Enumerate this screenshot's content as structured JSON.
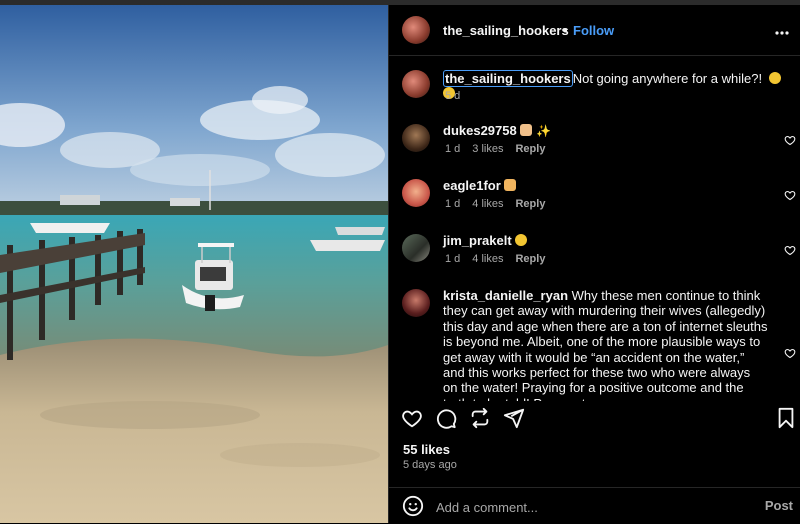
{
  "post": {
    "author": "the_sailing_hookers",
    "separator": "•",
    "follow_label": "Follow",
    "more_label": "•••",
    "caption": {
      "username": "the_sailing_hookers",
      "text": "Not going anywhere for a while?!",
      "time": "5 d"
    }
  },
  "comments": [
    {
      "username": "dukes29758",
      "text": "",
      "time": "1 d",
      "likes": "3 likes",
      "reply": "Reply"
    },
    {
      "username": "eagle1for",
      "text": "",
      "time": "1 d",
      "likes": "4 likes",
      "reply": "Reply"
    },
    {
      "username": "jim_prakelt",
      "text": "",
      "time": "1 d",
      "likes": "4 likes",
      "reply": "Reply"
    },
    {
      "username": "krista_danielle_ryan",
      "text": "Why these men continue to think they can get away with murdering their wives (allegedly) this day and age when there are a ton of internet sleuths is beyond me. Albeit, one of the more plausible ways to get away with it would be “an accident on the water,” and this works perfect for these two who were always on the water! Praying for a positive outcome and the truth to be told! Prayers to"
    }
  ],
  "stats": {
    "likes": "55 likes",
    "time_ago": "5 days ago"
  },
  "add_comment": {
    "placeholder": "Add a comment...",
    "post_label": "Post"
  },
  "colors": {
    "background": "#000000",
    "text": "#f5f5f5",
    "muted": "#a8a8a8",
    "accent": "#4a9df8",
    "divider": "#262626"
  },
  "icons": [
    "heart-icon",
    "comment-icon",
    "share-icon",
    "send-icon",
    "bookmark-icon",
    "emoji-icon",
    "more-icon"
  ]
}
